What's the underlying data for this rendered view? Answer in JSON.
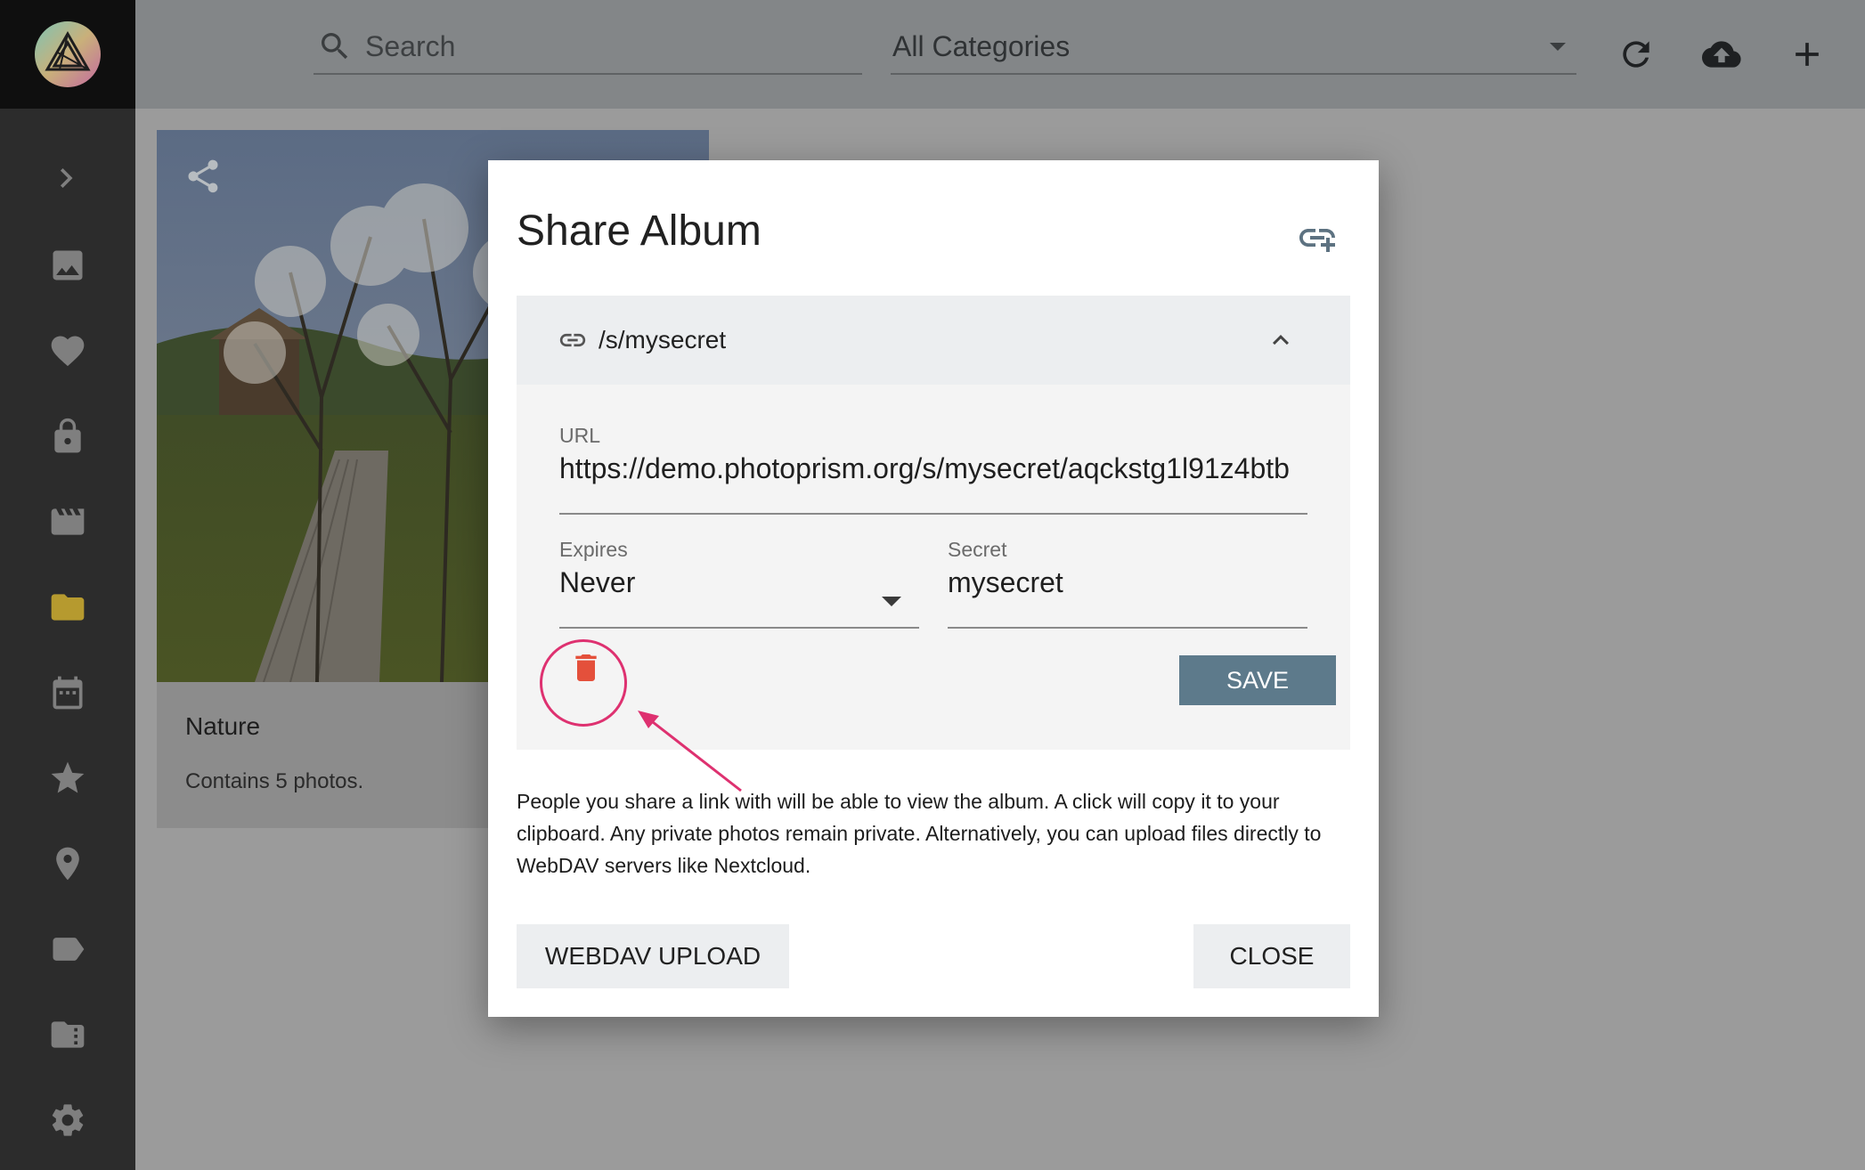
{
  "sidebar": {
    "items": [
      {
        "icon": "chevron-right-icon"
      },
      {
        "icon": "photo-icon"
      },
      {
        "icon": "heart-icon"
      },
      {
        "icon": "lock-icon"
      },
      {
        "icon": "movie-icon"
      },
      {
        "icon": "folder-icon",
        "active": true
      },
      {
        "icon": "calendar-icon"
      },
      {
        "icon": "star-icon"
      },
      {
        "icon": "place-icon"
      },
      {
        "icon": "label-icon"
      },
      {
        "icon": "album-folder-icon"
      },
      {
        "icon": "settings-icon"
      }
    ],
    "active_color": "#b69a2f"
  },
  "toolbar": {
    "search_placeholder": "Search",
    "category_value": "All Categories",
    "icons": [
      "refresh-icon",
      "cloud-upload-icon",
      "add-icon"
    ]
  },
  "album_card": {
    "title": "Nature",
    "description": "Contains 5 photos."
  },
  "dialog": {
    "title": "Share Album",
    "link_path": "/s/mysecret",
    "url_label": "URL",
    "url_value": "https://demo.photoprism.org/s/mysecret/aqckstg1l91z4btb",
    "expires_label": "Expires",
    "expires_value": "Never",
    "secret_label": "Secret",
    "secret_value": "mysecret",
    "save_label": "SAVE",
    "info_text": "People you share a link with will be able to view the album. A click will copy it to your clipboard. Any private photos remain private. Alternatively, you can upload files directly to WebDAV servers like Nextcloud.",
    "webdav_label": "WEBDAV UPLOAD",
    "close_label": "CLOSE"
  },
  "colors": {
    "save_button": "#5d7a8b",
    "delete_icon": "#e4503b",
    "highlight": "#de3170"
  }
}
